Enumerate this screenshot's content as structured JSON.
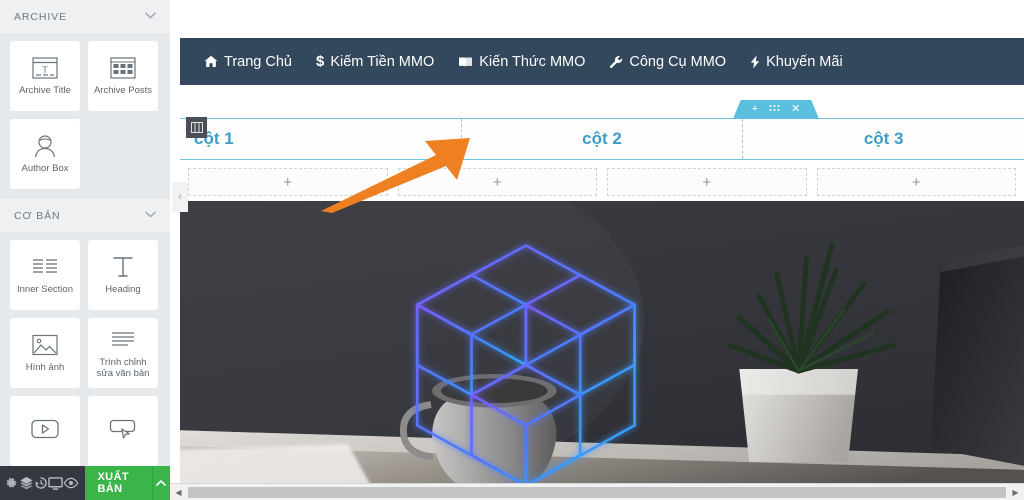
{
  "panel": {
    "sections": [
      {
        "title": "ARCHIVE",
        "chevron": "chevron-down-icon",
        "widgets": [
          {
            "label": "Archive Title",
            "icon": "archive-title-icon"
          },
          {
            "label": "Archive Posts",
            "icon": "archive-posts-icon"
          },
          {
            "label": "Author Box",
            "icon": "author-box-icon"
          }
        ]
      },
      {
        "title": "CƠ BẢN",
        "chevron": "chevron-down-icon",
        "widgets": [
          {
            "label": "Inner Section",
            "icon": "inner-section-icon"
          },
          {
            "label": "Heading",
            "icon": "heading-icon"
          },
          {
            "label": "Hình ảnh",
            "icon": "image-icon"
          },
          {
            "label": "Trình chỉnh sửa văn bản",
            "icon": "text-editor-icon"
          },
          {
            "label": "",
            "icon": "video-icon"
          },
          {
            "label": "",
            "icon": "button-icon"
          }
        ]
      }
    ]
  },
  "bottombar": {
    "icons": [
      "settings-gear-icon",
      "layers-navigator-icon",
      "history-icon",
      "responsive-mode-icon",
      "preview-eye-icon"
    ],
    "publish_label": "XUẤT BẢN",
    "publish_caret": "caret-up-icon",
    "publish_color": "#3bb54a"
  },
  "navbar": {
    "background": "#33475d",
    "items": [
      {
        "icon": "home-icon",
        "glyph": "⌂",
        "label": "Trang Chủ"
      },
      {
        "icon": "dollar-icon",
        "glyph": "$",
        "label": "Kiếm Tiền MMO"
      },
      {
        "icon": "book-icon",
        "glyph": "▤",
        "label": "Kiến Thức MMO"
      },
      {
        "icon": "wrench-icon",
        "glyph": "⚒",
        "label": "Công Cụ MMO"
      },
      {
        "icon": "bolt-icon",
        "glyph": "⚡",
        "label": "Khuyến Mãi"
      }
    ]
  },
  "section_handle": {
    "add": "+",
    "drag": "⁙",
    "close": "✕",
    "color": "#5bc0de"
  },
  "section_edit_icon": "column-layout-icon",
  "columns": {
    "accent": "#3e9ec7",
    "items": [
      {
        "label": "cột 1"
      },
      {
        "label": "cột 2"
      },
      {
        "label": "cột 3"
      }
    ]
  },
  "add_widgets": {
    "plus": "+",
    "boxes": [
      "add-widget-1",
      "add-widget-2",
      "add-widget-3",
      "add-widget-4"
    ]
  },
  "collapse_chevron": "‹",
  "hero": {
    "alt": "desk-photo-with-neon-cube",
    "background": "#36373c"
  },
  "scrollbar": {
    "left_arrow": "◀",
    "right_arrow": "▶"
  },
  "annotation": {
    "arrow_color": "#ef8022",
    "points_at": "cột 2"
  }
}
